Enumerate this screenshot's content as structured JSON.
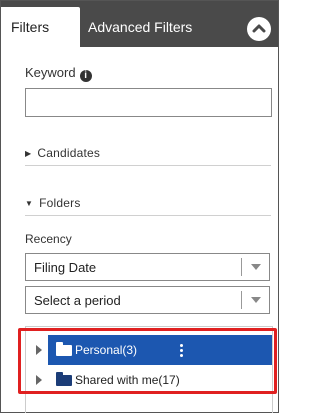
{
  "tabs": {
    "filters": "Filters",
    "advanced": "Advanced Filters"
  },
  "keyword": {
    "label": "Keyword",
    "value": ""
  },
  "sections": {
    "candidates": "Candidates",
    "folders": "Folders"
  },
  "recency": {
    "label": "Recency",
    "sort_value": "Filing Date",
    "period_value": "Select a period"
  },
  "tree": {
    "items": [
      {
        "label": "Personal(3)",
        "selected": true
      },
      {
        "label": "Shared with me(17)",
        "selected": false
      }
    ]
  },
  "colors": {
    "tabbar": "#4a4a4a",
    "selected_row": "#1c57b0",
    "folder": "#1c3d78",
    "highlight_border": "#e02020"
  }
}
